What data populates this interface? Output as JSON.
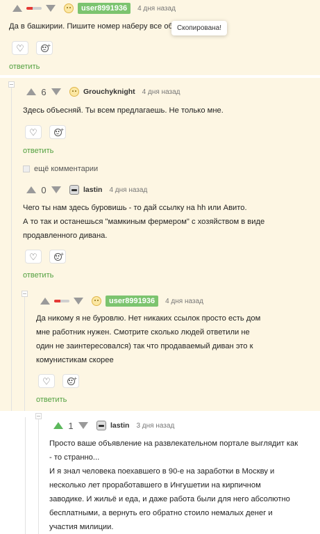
{
  "reply_label": "ответить",
  "more_comments_label": "ещё комментарии",
  "tooltip_text": "Скопирована!",
  "colors": {
    "highlight_bg": "#fdf6e3",
    "badge_green": "#7cc46f",
    "reply_green": "#51a03f",
    "vote_up_active": "#5cb85c"
  },
  "comments": [
    {
      "user": "user8991936",
      "user_style": "badge",
      "avatar": "cat-icon",
      "time": "4 дня назад",
      "score": "",
      "rating_fraction": 0.4,
      "lines": [
        "Да в башкирии. Пишите номер наберу все об"
      ]
    },
    {
      "user": "Grouchyknight",
      "user_style": "nick",
      "avatar": "cat-icon",
      "time": "4 дня назад",
      "score": "6",
      "lines": [
        "Здесь объесняй. Ты всем предлагаешь. Не только мне."
      ]
    },
    {
      "user": "lastin",
      "user_style": "nick",
      "avatar": "car-icon",
      "time": "4 дня назад",
      "score": "0",
      "lines": [
        "Чего ты нам здесь буровишь - то дай ссылку на hh или Авито.",
        "А то так и останешься \"мамкиным фермером\" с хозяйством в виде",
        "продавленного дивана."
      ]
    },
    {
      "user": "user8991936",
      "user_style": "badge",
      "avatar": "cat-icon",
      "time": "4 дня назад",
      "score": "",
      "rating_fraction": 0.4,
      "lines": [
        "Да никому я не буровлю. Нет никаких ссылок просто есть дом",
        "мне работник нужен. Смотрите сколько людей ответили не",
        "один не заинтересовался) так что продаваемый диван это к",
        "комунистикам скорее"
      ]
    },
    {
      "user": "lastin",
      "user_style": "nick",
      "avatar": "car-icon",
      "time": "3 дня назад",
      "score": "1",
      "lines": [
        "Просто ваше объявление на развлекательном портале выглядит как",
        "- то странно...",
        "И я знал человека поехавшего в 90-е на заработки в Москву и",
        "несколько лет проработавшего в Ингушетии на кирпичном",
        "заводике. И жильё и еда, и даже работа были для него абсолютно",
        "бесплатными, а вернуть его обратно стоило немалых денег и",
        "участия милиции."
      ]
    }
  ]
}
